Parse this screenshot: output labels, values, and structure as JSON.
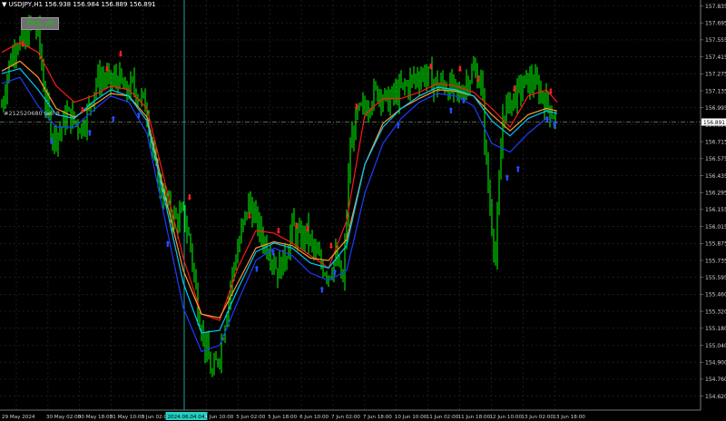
{
  "header": {
    "symbol": "USDJPY,H1",
    "quote": "156.938 156.984 156.889 156.891"
  },
  "button": {
    "label": "TP/SL off"
  },
  "position_label": "#212520680 sell 8",
  "price_tag": "156.891",
  "price_scale": [
    "157.835",
    "157.695",
    "157.555",
    "157.415",
    "157.275",
    "157.135",
    "156.995",
    "156.855",
    "156.715",
    "156.575",
    "156.435",
    "156.295",
    "156.155",
    "156.015",
    "155.875",
    "155.735",
    "155.595",
    "155.460",
    "155.320",
    "155.180",
    "155.040",
    "154.900",
    "154.760",
    "154.620"
  ],
  "time_scale": [
    "29 May 2024",
    "30 May 02:00",
    "30 May 18:00",
    "31 May 10:00",
    "3 Jun 02:00",
    "2024.06.04 04:00",
    "4 Jun 10:00",
    "5 Jun 02:00",
    "5 Jun 18:00",
    "6 Jun 10:00",
    "7 Jun 02:00",
    "7 Jun 18:00",
    "10 Jun 10:00",
    "11 Jun 02:00",
    "11 Jun 18:00",
    "12 Jun 10:00",
    "13 Jun 02:00",
    "13 Jun 18:00"
  ],
  "colors": {
    "background": "#000000",
    "candles": "#00ff00",
    "ma_red": "#ff1a1a",
    "ma_orange": "#ff9a2e",
    "ma_blue": "#1e3cff",
    "ma_cyan": "#00c8ff",
    "crosshair": "#20d0c0",
    "grid": "#2c2c2c"
  },
  "chart_data": {
    "type": "candlestick",
    "symbol": "USDJPY",
    "timeframe": "H1",
    "current_price": 156.891,
    "ylim": [
      154.58,
      157.87
    ],
    "grid": true,
    "series": [
      {
        "name": "close",
        "x": [
          0,
          8,
          16,
          24,
          32,
          40,
          48,
          56,
          64,
          72,
          80,
          88,
          96,
          104,
          112,
          120,
          128,
          136,
          144,
          152,
          160,
          168,
          176,
          184,
          192,
          200,
          208,
          216,
          224,
          232,
          240,
          248,
          256,
          264,
          272,
          280,
          288,
          296,
          304,
          312,
          320,
          328,
          336,
          344,
          352,
          360,
          368,
          376,
          384,
          392,
          400,
          408,
          416,
          424,
          432,
          440,
          448,
          456,
          464,
          472,
          480,
          488,
          496,
          504,
          512,
          520,
          528,
          536,
          544,
          552,
          560,
          568,
          576,
          584,
          592,
          600,
          608,
          612
        ],
        "values": [
          157.02,
          157.35,
          157.55,
          157.5,
          157.68,
          157.62,
          157.05,
          156.78,
          156.82,
          156.95,
          156.9,
          156.85,
          157.0,
          157.22,
          157.25,
          157.2,
          157.25,
          157.12,
          157.18,
          157.1,
          157.0,
          156.55,
          156.35,
          156.2,
          156.1,
          156.15,
          155.9,
          155.4,
          155.1,
          154.85,
          155.05,
          155.4,
          155.75,
          156.0,
          156.25,
          156.1,
          155.95,
          155.85,
          155.7,
          155.8,
          156.05,
          155.95,
          156.0,
          155.85,
          155.75,
          155.68,
          155.8,
          155.6,
          156.7,
          156.95,
          157.0,
          157.1,
          157.15,
          157.05,
          157.1,
          157.15,
          157.2,
          157.25,
          157.28,
          157.25,
          157.18,
          157.2,
          157.15,
          157.1,
          157.22,
          157.3,
          157.22,
          156.35,
          155.8,
          156.95,
          157.05,
          157.12,
          157.2,
          157.22,
          157.15,
          157.05,
          156.95,
          156.89
        ]
      },
      {
        "name": "ma-red",
        "x": [
          0,
          20,
          40,
          60,
          80,
          100,
          120,
          140,
          160,
          180,
          200,
          220,
          240,
          260,
          280,
          300,
          320,
          340,
          360,
          380,
          400,
          420,
          440,
          460,
          480,
          500,
          520,
          540,
          560,
          580,
          600,
          612
        ],
        "values": [
          157.45,
          157.53,
          157.45,
          157.18,
          157.05,
          157.1,
          157.18,
          157.15,
          157.0,
          156.4,
          155.8,
          155.35,
          155.3,
          155.72,
          156.02,
          156.0,
          155.92,
          155.82,
          155.72,
          156.1,
          156.95,
          157.08,
          157.08,
          157.13,
          157.2,
          157.18,
          157.13,
          157.0,
          156.85,
          157.1,
          157.15,
          157.05
        ]
      },
      {
        "name": "ma-orange",
        "x": [
          0,
          20,
          40,
          60,
          80,
          100,
          120,
          140,
          160,
          180,
          200,
          220,
          240,
          260,
          280,
          300,
          320,
          340,
          360,
          380,
          400,
          420,
          440,
          460,
          480,
          500,
          520,
          540,
          560,
          580,
          600,
          612
        ],
        "values": [
          157.3,
          157.38,
          157.25,
          157.0,
          156.93,
          157.02,
          157.12,
          157.1,
          156.93,
          156.3,
          155.7,
          155.35,
          155.32,
          155.6,
          155.88,
          155.93,
          155.9,
          155.8,
          155.78,
          155.95,
          156.55,
          156.88,
          157.0,
          157.08,
          157.15,
          157.14,
          157.1,
          156.95,
          156.82,
          156.95,
          157.0,
          156.98
        ]
      },
      {
        "name": "ma-blue",
        "x": [
          0,
          20,
          40,
          60,
          80,
          100,
          120,
          140,
          160,
          180,
          200,
          220,
          240,
          260,
          280,
          300,
          320,
          340,
          360,
          380,
          400,
          420,
          440,
          460,
          480,
          500,
          520,
          540,
          560,
          580,
          600,
          612
        ],
        "values": [
          157.2,
          157.25,
          157.02,
          156.85,
          156.85,
          156.98,
          157.1,
          157.05,
          156.8,
          156.1,
          155.4,
          155.05,
          155.1,
          155.45,
          155.78,
          155.88,
          155.82,
          155.68,
          155.62,
          155.7,
          156.32,
          156.72,
          156.92,
          157.05,
          157.12,
          157.1,
          157.02,
          156.72,
          156.65,
          156.8,
          156.92,
          156.88
        ]
      },
      {
        "name": "ma-cyan",
        "x": [
          0,
          20,
          40,
          60,
          80,
          100,
          120,
          140,
          160,
          180,
          200,
          220,
          240,
          260,
          280,
          300,
          320,
          340,
          360,
          380,
          400,
          420,
          440,
          460,
          480,
          500,
          520,
          540,
          560,
          580,
          600,
          612
        ],
        "values": [
          157.28,
          157.32,
          157.15,
          156.95,
          156.92,
          157.05,
          157.15,
          157.1,
          156.9,
          156.25,
          155.6,
          155.2,
          155.22,
          155.55,
          155.85,
          155.92,
          155.88,
          155.76,
          155.72,
          155.9,
          156.55,
          156.85,
          157.0,
          157.1,
          157.17,
          157.15,
          157.1,
          156.9,
          156.78,
          156.92,
          156.98,
          156.96
        ]
      }
    ],
    "sell_signals": [
      [
        22,
        157.48
      ],
      [
        88,
        156.95
      ],
      [
        115,
        157.28
      ],
      [
        130,
        157.4
      ],
      [
        206,
        156.25
      ],
      [
        272,
        156.1
      ],
      [
        304,
        155.98
      ],
      [
        324,
        156.02
      ],
      [
        336,
        156.0
      ],
      [
        362,
        155.86
      ],
      [
        390,
        156.98
      ],
      [
        472,
        157.3
      ],
      [
        504,
        157.28
      ],
      [
        524,
        157.2
      ],
      [
        564,
        157.12
      ],
      [
        604,
        157.1
      ]
    ],
    "buy_signals": [
      [
        54,
        156.77
      ],
      [
        96,
        156.84
      ],
      [
        122,
        156.95
      ],
      [
        150,
        156.98
      ],
      [
        182,
        155.95
      ],
      [
        280,
        155.75
      ],
      [
        298,
        155.88
      ],
      [
        352,
        155.58
      ],
      [
        366,
        155.72
      ],
      [
        436,
        156.9
      ],
      [
        494,
        157.02
      ],
      [
        508,
        157.1
      ],
      [
        556,
        156.48
      ],
      [
        568,
        156.55
      ],
      [
        600,
        156.95
      ],
      [
        608,
        156.9
      ]
    ]
  }
}
